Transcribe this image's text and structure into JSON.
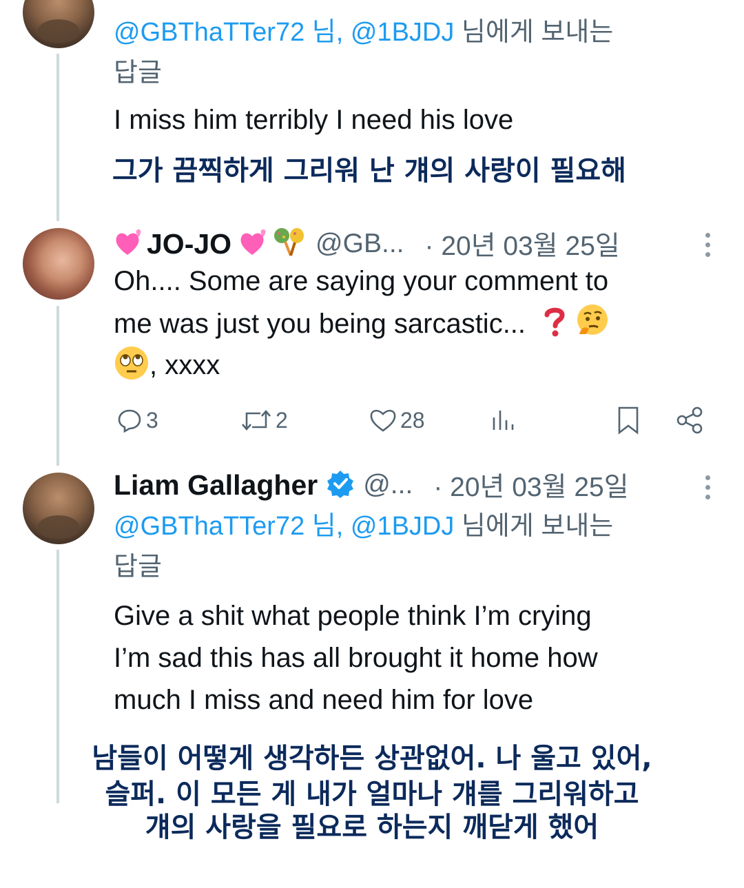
{
  "tweet_top": {
    "reply_prefix_mentions": "@GBThaTTer72 님, @1BJDJ",
    "reply_suffix": " 님에게 보내는",
    "reply_line2": "답글",
    "text": "I miss him terribly I need his love",
    "translation": "그가 끔찍하게 그리워 난 걔의 사랑이 필요해"
  },
  "tweet_jojo": {
    "display_name": "JO-JO",
    "handle": "@GB...",
    "timestamp": "· 20년 03월 25일",
    "text_line1": "Oh.... Some are saying your comment to",
    "text_line2": "me was just you being sarcastic...",
    "text_line3_suffix": ", xxxx",
    "actions": {
      "replies": "3",
      "retweets": "2",
      "likes": "28"
    }
  },
  "tweet_liam": {
    "display_name": "Liam Gallagher",
    "handle": "@...",
    "timestamp": "· 20년 03월 25일",
    "reply_prefix_mentions": "@GBThaTTer72 님, @1BJDJ",
    "reply_suffix": " 님에게 보내는",
    "reply_line2": "답글",
    "text_line1": "Give a shit what people think I’m crying",
    "text_line2": "I’m sad this has all brought it home how",
    "text_line3": "much I miss and need him for love",
    "translation_line1": "남들이 어떻게 생각하든 상관없어. 나 울고 있어,",
    "translation_line2": "슬퍼. 이 모든 게 내가 얼마나 걔를 그리워하고",
    "translation_line3": "걔의 사랑을 필요로 하는지 깨닫게 했어"
  },
  "colors": {
    "mention": "#1d9bf0",
    "secondary": "#536471",
    "translation": "#0c2a5b",
    "verified": "#1d9bf0"
  }
}
